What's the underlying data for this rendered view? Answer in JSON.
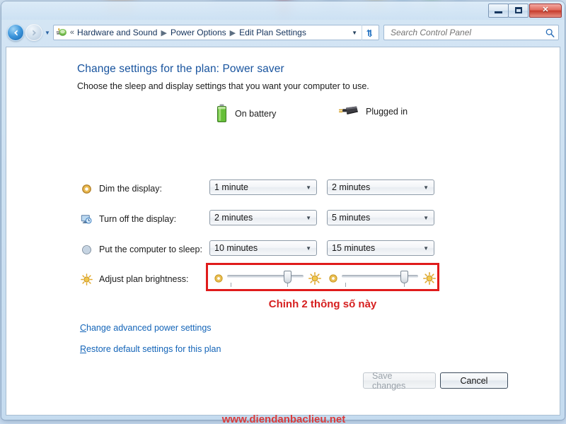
{
  "window": {
    "controls": {
      "minimize": "Minimize",
      "maximize": "Maximize",
      "close": "✕"
    }
  },
  "navigation": {
    "back": "◀",
    "forward": "▶",
    "recent_pages": "▼",
    "address_icon": "power-options-icon",
    "breadcrumb_prefix": "«",
    "breadcrumbs": [
      {
        "label": "Hardware and Sound"
      },
      {
        "label": "Power Options"
      },
      {
        "label": "Edit Plan Settings"
      }
    ],
    "separator": "▶",
    "address_dropdown": "▼",
    "refresh": "refresh-icon"
  },
  "search": {
    "placeholder": "Search Control Panel",
    "value": "",
    "icon": "search-icon"
  },
  "page": {
    "title": "Change settings for the plan: Power saver",
    "subtitle": "Choose the sleep and display settings that you want your computer to use."
  },
  "columns": [
    {
      "label": "On battery",
      "icon": "battery-icon"
    },
    {
      "label": "Plugged in",
      "icon": "power-plug-icon"
    }
  ],
  "settings_rows": [
    {
      "icon": "dim-display-icon",
      "label": "Dim the display:",
      "on_battery": "1 minute",
      "plugged_in": "2 minutes"
    },
    {
      "icon": "turn-off-display-icon",
      "label": "Turn off the display:",
      "on_battery": "2 minutes",
      "plugged_in": "5 minutes"
    },
    {
      "icon": "sleep-icon",
      "label": "Put the computer to sleep:",
      "on_battery": "10 minutes",
      "plugged_in": "15 minutes"
    }
  ],
  "brightness": {
    "icon": "brightness-sun-icon",
    "label": "Adjust plan brightness:",
    "on_battery_percent": 85,
    "plugged_in_percent": 88,
    "low_icon": "brightness-low-icon",
    "high_icon": "brightness-high-icon",
    "highlight_color": "#e01b1b"
  },
  "annotation": {
    "text": "Chỉnh 2 thông số này",
    "color": "#d61f1f"
  },
  "links": [
    {
      "accesskey": "C",
      "rest": "hange advanced power settings"
    },
    {
      "accesskey": "R",
      "rest": "estore default settings for this plan"
    }
  ],
  "buttons": {
    "save": "Save changes",
    "save_enabled": false,
    "cancel": "Cancel",
    "cancel_enabled": true
  },
  "watermark": {
    "text": "www.diendanbaclieu.net",
    "color": "#d93b3b"
  }
}
